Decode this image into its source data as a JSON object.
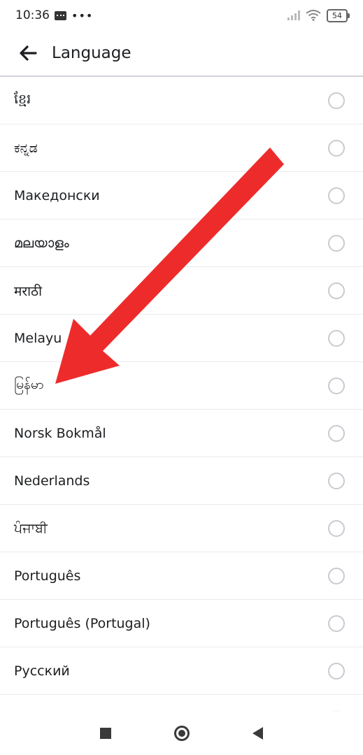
{
  "status_bar": {
    "time": "10:36",
    "dots": "•••",
    "battery": "54"
  },
  "header": {
    "title": "Language"
  },
  "languages": [
    {
      "label": "ខ្មែរ",
      "selected": false
    },
    {
      "label": "ಕನ್ನಡ",
      "selected": false
    },
    {
      "label": "Македонски",
      "selected": false
    },
    {
      "label": "മലയാളം",
      "selected": false
    },
    {
      "label": "मराठी",
      "selected": false
    },
    {
      "label": "Melayu",
      "selected": false
    },
    {
      "label": "မြန်မာ",
      "selected": false
    },
    {
      "label": "Norsk Bokmål",
      "selected": false
    },
    {
      "label": "Nederlands",
      "selected": false
    },
    {
      "label": "ਪੰਜਾਬੀ",
      "selected": false
    },
    {
      "label": "Português",
      "selected": false
    },
    {
      "label": "Português (Portugal)",
      "selected": false
    },
    {
      "label": "Русский",
      "selected": false
    }
  ],
  "annotation": {
    "arrow_color": "#ee2b2b"
  },
  "icons": {
    "back": "arrow-left-icon",
    "recents": "square-icon",
    "home": "circle-icon",
    "nav_back": "triangle-left-icon"
  }
}
